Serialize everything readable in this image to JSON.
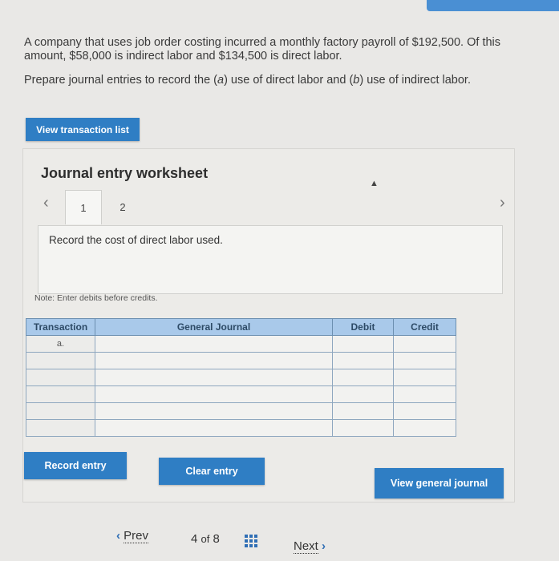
{
  "question": {
    "line1": "A company that uses job order costing incurred a monthly factory payroll of $192,500. Of this amount, $58,000 is indirect labor and $134,500 is direct labor.",
    "line2": "Prepare journal entries to record the (a) use of direct labor and (b) use of indirect labor."
  },
  "buttons": {
    "view_transactions": "View transaction list",
    "record_entry": "Record entry",
    "clear_entry": "Clear entry",
    "view_general_journal": "View general journal"
  },
  "worksheet": {
    "title": "Journal entry worksheet",
    "tabs": [
      "1",
      "2"
    ],
    "active_tab": "1",
    "instruction": "Record the cost of direct labor used.",
    "note": "Note: Enter debits before credits."
  },
  "table": {
    "headers": [
      "Transaction",
      "General Journal",
      "Debit",
      "Credit"
    ],
    "rows": [
      {
        "transaction": "a.",
        "account": "",
        "debit": "",
        "credit": ""
      },
      {
        "transaction": "",
        "account": "",
        "debit": "",
        "credit": ""
      },
      {
        "transaction": "",
        "account": "",
        "debit": "",
        "credit": ""
      },
      {
        "transaction": "",
        "account": "",
        "debit": "",
        "credit": ""
      },
      {
        "transaction": "",
        "account": "",
        "debit": "",
        "credit": ""
      },
      {
        "transaction": "",
        "account": "",
        "debit": "",
        "credit": ""
      }
    ]
  },
  "pagination": {
    "prev": "Prev",
    "current": "4",
    "of": "of",
    "total": "8",
    "next": "Next"
  },
  "colors": {
    "accent": "#2f7ec4",
    "table_header": "#a9c9ea"
  }
}
